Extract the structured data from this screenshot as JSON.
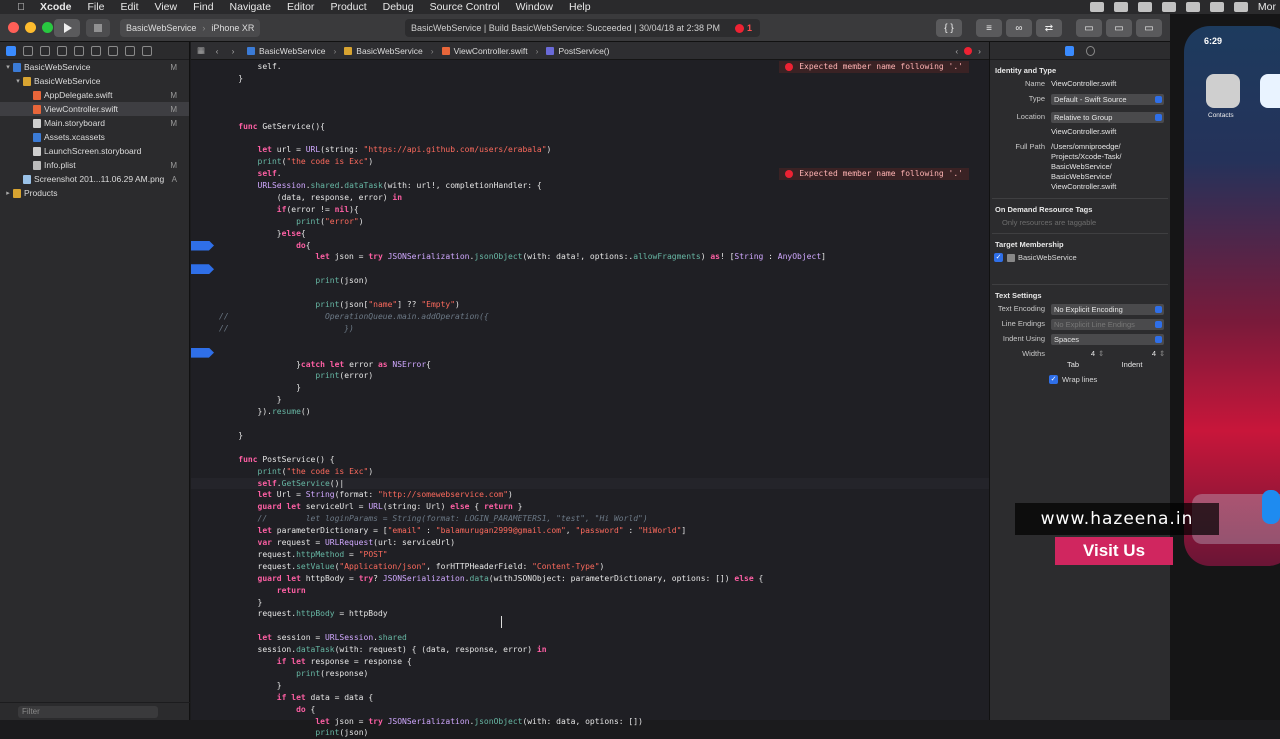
{
  "menubar": {
    "app_name": "Xcode",
    "items": [
      "File",
      "Edit",
      "View",
      "Find",
      "Navigate",
      "Editor",
      "Product",
      "Debug",
      "Source Control",
      "Window",
      "Help"
    ],
    "right_text": "Mor"
  },
  "toolbar": {
    "scheme": "BasicWebService",
    "device": "iPhone XR",
    "activity": "BasicWebService | Build BasicWebService: Succeeded | 30/04/18 at 2:38 PM",
    "error_count": "1"
  },
  "navigator": {
    "items": [
      {
        "label": "BasicWebService",
        "badge": "M",
        "depth": 0,
        "kind": "project",
        "open": true
      },
      {
        "label": "BasicWebService",
        "badge": "",
        "depth": 1,
        "kind": "folder",
        "open": true
      },
      {
        "label": "AppDelegate.swift",
        "badge": "M",
        "depth": 2,
        "kind": "swift"
      },
      {
        "label": "ViewController.swift",
        "badge": "M",
        "depth": 2,
        "kind": "swift",
        "selected": true
      },
      {
        "label": "Main.storyboard",
        "badge": "M",
        "depth": 2,
        "kind": "storyboard"
      },
      {
        "label": "Assets.xcassets",
        "badge": "",
        "depth": 2,
        "kind": "assets"
      },
      {
        "label": "LaunchScreen.storyboard",
        "badge": "",
        "depth": 2,
        "kind": "storyboard"
      },
      {
        "label": "Info.plist",
        "badge": "M",
        "depth": 2,
        "kind": "plist"
      },
      {
        "label": "Screenshot 201...11.06.29 AM.png",
        "badge": "A",
        "depth": 1,
        "kind": "image"
      },
      {
        "label": "Products",
        "badge": "",
        "depth": 0,
        "kind": "folder",
        "open": false
      }
    ],
    "filter_placeholder": "Filter"
  },
  "jumpbar": {
    "crumbs": [
      "BasicWebService",
      "BasicWebService",
      "ViewController.swift",
      "PostService()"
    ]
  },
  "errors": [
    {
      "text": "Expected member name following '.'",
      "line": 0
    },
    {
      "text": "Expected member name following '.'",
      "line": 9
    }
  ],
  "code_lines": [
    [
      [
        "plain",
        "        self."
      ]
    ],
    [
      [
        "plain",
        "    }"
      ]
    ],
    [
      [
        "plain",
        ""
      ]
    ],
    [
      [
        "plain",
        ""
      ]
    ],
    [
      [
        "plain",
        ""
      ]
    ],
    [
      [
        "kw",
        "    func "
      ],
      [
        "plain",
        "GetService(){"
      ]
    ],
    [
      [
        "plain",
        ""
      ]
    ],
    [
      [
        "kw",
        "        let "
      ],
      [
        "plain",
        "url = "
      ],
      [
        "typ",
        "URL"
      ],
      [
        "plain",
        "(string: "
      ],
      [
        "str",
        "\"https://api.github.com/users/erabala\""
      ],
      [
        "plain",
        ")"
      ]
    ],
    [
      [
        "fn",
        "        print"
      ],
      [
        "plain",
        "("
      ],
      [
        "str",
        "\"the code is Exc\""
      ],
      [
        "plain",
        ")"
      ]
    ],
    [
      [
        "kw",
        "        self"
      ],
      [
        "plain",
        "."
      ]
    ],
    [
      [
        "typ",
        "        URLSession"
      ],
      [
        "plain",
        "."
      ],
      [
        "fn",
        "shared"
      ],
      [
        "plain",
        "."
      ],
      [
        "fn",
        "dataTask"
      ],
      [
        "plain",
        "(with: url!, completionHandler: {"
      ]
    ],
    [
      [
        "plain",
        "            (data, response, error) "
      ],
      [
        "kw",
        "in"
      ]
    ],
    [
      [
        "kw",
        "            if"
      ],
      [
        "plain",
        "(error != "
      ],
      [
        "kw",
        "nil"
      ],
      [
        "plain",
        "){"
      ]
    ],
    [
      [
        "fn",
        "                print"
      ],
      [
        "plain",
        "("
      ],
      [
        "str",
        "\"error\""
      ],
      [
        "plain",
        ")"
      ]
    ],
    [
      [
        "plain",
        "            }"
      ],
      [
        "kw",
        "else"
      ],
      [
        "plain",
        "{"
      ]
    ],
    [
      [
        "kw",
        "                do"
      ],
      [
        "plain",
        "{"
      ]
    ],
    [
      [
        "kw",
        "                    let "
      ],
      [
        "plain",
        "json = "
      ],
      [
        "kw",
        "try "
      ],
      [
        "typ",
        "JSONSerialization"
      ],
      [
        "plain",
        "."
      ],
      [
        "fn",
        "jsonObject"
      ],
      [
        "plain",
        "(with: data!, options:."
      ],
      [
        "fn",
        "allowFragments"
      ],
      [
        "plain",
        ") "
      ],
      [
        "kw",
        "as"
      ],
      [
        "plain",
        "! ["
      ],
      [
        "typ",
        "String"
      ],
      [
        "plain",
        " : "
      ],
      [
        "typ",
        "AnyObject"
      ],
      [
        "plain",
        "]"
      ]
    ],
    [
      [
        "plain",
        ""
      ]
    ],
    [
      [
        "fn",
        "                    print"
      ],
      [
        "plain",
        "(json)"
      ]
    ],
    [
      [
        "plain",
        ""
      ]
    ],
    [
      [
        "fn",
        "                    print"
      ],
      [
        "plain",
        "(json["
      ],
      [
        "str",
        "\"name\""
      ],
      [
        "plain",
        "] ?? "
      ],
      [
        "str",
        "\"Empty\""
      ],
      [
        "plain",
        ")"
      ]
    ],
    [
      [
        "cm",
        "//                    OperationQueue.main.addOperation({"
      ]
    ],
    [
      [
        "cm",
        "//                        })"
      ]
    ],
    [
      [
        "plain",
        ""
      ]
    ],
    [
      [
        "plain",
        ""
      ]
    ],
    [
      [
        "plain",
        "                }"
      ],
      [
        "kw",
        "catch let "
      ],
      [
        "plain",
        "error "
      ],
      [
        "kw",
        "as "
      ],
      [
        "typ",
        "NSError"
      ],
      [
        "plain",
        "{"
      ]
    ],
    [
      [
        "fn",
        "                    print"
      ],
      [
        "plain",
        "(error)"
      ]
    ],
    [
      [
        "plain",
        "                }"
      ]
    ],
    [
      [
        "plain",
        "            }"
      ]
    ],
    [
      [
        "plain",
        "        })."
      ],
      [
        "fn",
        "resume"
      ],
      [
        "plain",
        "()"
      ]
    ],
    [
      [
        "plain",
        ""
      ]
    ],
    [
      [
        "plain",
        "    }"
      ]
    ],
    [
      [
        "plain",
        ""
      ]
    ],
    [
      [
        "kw",
        "    func "
      ],
      [
        "plain",
        "PostService() {"
      ]
    ],
    [
      [
        "fn",
        "        print"
      ],
      [
        "plain",
        "("
      ],
      [
        "str",
        "\"the code is Exc\""
      ],
      [
        "plain",
        ")"
      ]
    ],
    [
      [
        "kw",
        "        self"
      ],
      [
        "plain",
        "."
      ],
      [
        "fn",
        "GetService"
      ],
      [
        "plain",
        "()|"
      ]
    ],
    [
      [
        "kw",
        "        let "
      ],
      [
        "plain",
        "Url = "
      ],
      [
        "typ",
        "String"
      ],
      [
        "plain",
        "(format: "
      ],
      [
        "str",
        "\"http://somewebservice.com\""
      ],
      [
        "plain",
        ")"
      ]
    ],
    [
      [
        "kw",
        "        guard let "
      ],
      [
        "plain",
        "serviceUrl = "
      ],
      [
        "typ",
        "URL"
      ],
      [
        "plain",
        "(string: Url) "
      ],
      [
        "kw",
        "else "
      ],
      [
        "plain",
        "{ "
      ],
      [
        "kw",
        "return "
      ],
      [
        "plain",
        "}"
      ]
    ],
    [
      [
        "cm",
        "        //        let loginParams = String(format: LOGIN_PARAMETERS1, \"test\", \"Hi World\")"
      ]
    ],
    [
      [
        "kw",
        "        let "
      ],
      [
        "plain",
        "parameterDictionary = ["
      ],
      [
        "str",
        "\"email\""
      ],
      [
        "plain",
        " : "
      ],
      [
        "str",
        "\"balamurugan2999@gmail.com\""
      ],
      [
        "plain",
        ", "
      ],
      [
        "str",
        "\"password\""
      ],
      [
        "plain",
        " : "
      ],
      [
        "str",
        "\"HiWorld\""
      ],
      [
        "plain",
        "]"
      ]
    ],
    [
      [
        "kw",
        "        var "
      ],
      [
        "plain",
        "request = "
      ],
      [
        "typ",
        "URLRequest"
      ],
      [
        "plain",
        "(url: serviceUrl)"
      ]
    ],
    [
      [
        "plain",
        "        request."
      ],
      [
        "fn",
        "httpMethod"
      ],
      [
        "plain",
        " = "
      ],
      [
        "str",
        "\"POST\""
      ]
    ],
    [
      [
        "plain",
        "        request."
      ],
      [
        "fn",
        "setValue"
      ],
      [
        "plain",
        "("
      ],
      [
        "str",
        "\"Application/json\""
      ],
      [
        "plain",
        ", forHTTPHeaderField: "
      ],
      [
        "str",
        "\"Content-Type\""
      ],
      [
        "plain",
        ")"
      ]
    ],
    [
      [
        "kw",
        "        guard let "
      ],
      [
        "plain",
        "httpBody = "
      ],
      [
        "kw",
        "try"
      ],
      [
        "plain",
        "? "
      ],
      [
        "typ",
        "JSONSerialization"
      ],
      [
        "plain",
        "."
      ],
      [
        "fn",
        "data"
      ],
      [
        "plain",
        "(withJSONObject: parameterDictionary, options: []) "
      ],
      [
        "kw",
        "else "
      ],
      [
        "plain",
        "{"
      ]
    ],
    [
      [
        "kw",
        "            return"
      ]
    ],
    [
      [
        "plain",
        "        }"
      ]
    ],
    [
      [
        "plain",
        "        request."
      ],
      [
        "fn",
        "httpBody"
      ],
      [
        "plain",
        " = httpBody"
      ]
    ],
    [
      [
        "plain",
        ""
      ]
    ],
    [
      [
        "kw",
        "        let "
      ],
      [
        "plain",
        "session = "
      ],
      [
        "typ",
        "URLSession"
      ],
      [
        "plain",
        "."
      ],
      [
        "fn",
        "shared"
      ]
    ],
    [
      [
        "plain",
        "        session."
      ],
      [
        "fn",
        "dataTask"
      ],
      [
        "plain",
        "(with: request) { (data, response, error) "
      ],
      [
        "kw",
        "in"
      ]
    ],
    [
      [
        "kw",
        "            if let "
      ],
      [
        "plain",
        "response = response {"
      ]
    ],
    [
      [
        "fn",
        "                print"
      ],
      [
        "plain",
        "(response)"
      ]
    ],
    [
      [
        "plain",
        "            }"
      ]
    ],
    [
      [
        "kw",
        "            if let "
      ],
      [
        "plain",
        "data = data {"
      ]
    ],
    [
      [
        "kw",
        "                do "
      ],
      [
        "plain",
        "{"
      ]
    ],
    [
      [
        "kw",
        "                    let "
      ],
      [
        "plain",
        "json = "
      ],
      [
        "kw",
        "try "
      ],
      [
        "typ",
        "JSONSerialization"
      ],
      [
        "plain",
        "."
      ],
      [
        "fn",
        "jsonObject"
      ],
      [
        "plain",
        "(with: data, options: [])"
      ]
    ],
    [
      [
        "fn",
        "                    print"
      ],
      [
        "plain",
        "(json)"
      ]
    ]
  ],
  "breakpoint_lines": [
    15,
    17,
    24
  ],
  "highlight_line": 35,
  "inspector": {
    "identity_title": "Identity and Type",
    "name_label": "Name",
    "name_value": "ViewController.swift",
    "type_label": "Type",
    "type_value": "Default - Swift Source",
    "location_label": "Location",
    "location_value": "Relative to Group",
    "location_file": "ViewController.swift",
    "fullpath_label": "Full Path",
    "fullpath_value": "/Users/omniproedge/ Projects/Xcode-Task/ BasicWebService/ BasicWebService/ ViewController.swift",
    "odr_title": "On Demand Resource Tags",
    "odr_placeholder": "Only resources are taggable",
    "target_title": "Target Membership",
    "target_name": "BasicWebService",
    "text_title": "Text Settings",
    "encoding_label": "Text Encoding",
    "encoding_value": "No Explicit Encoding",
    "line_endings_label": "Line Endings",
    "line_endings_value": "No Explicit Line Endings",
    "indent_label": "Indent Using",
    "indent_value": "Spaces",
    "widths_label": "Widths",
    "tab_value": "4",
    "indent_width_value": "4",
    "tab_label": "Tab",
    "indent_sub_label": "Indent",
    "wrap_label": "Wrap lines"
  },
  "simulator": {
    "time": "6:29",
    "contacts_label": "Contacts"
  },
  "watermark": {
    "site": "www.hazeena.in",
    "cta": "Visit Us"
  },
  "colors": {
    "accent": "#2f6fe8",
    "error": "#e22233",
    "keyword": "#fc5fa3",
    "string": "#fc6a5d",
    "type": "#d0a8ff",
    "function": "#67b7a4"
  }
}
